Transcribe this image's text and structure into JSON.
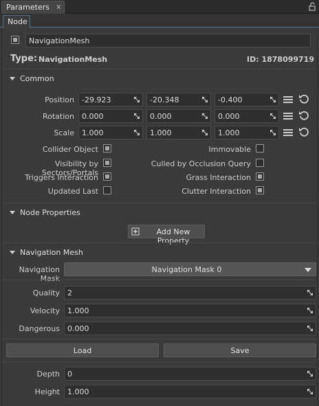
{
  "panel": {
    "tab_label": "Parameters",
    "tab_close": "x",
    "lock_icon": "lock-icon"
  },
  "node_tab": {
    "label": "Node"
  },
  "node": {
    "name": "NavigationMesh",
    "type_label": "Type:",
    "type_value": "NavigationMesh",
    "id_text": "ID: 1878099719",
    "enabled": true
  },
  "common": {
    "title": "Common",
    "position": {
      "label": "Position",
      "x": "-29.923",
      "y": "-20.348",
      "z": "-0.400"
    },
    "rotation": {
      "label": "Rotation",
      "x": "0.000",
      "y": "0.000",
      "z": "0.000"
    },
    "scale": {
      "label": "Scale",
      "x": "1.000",
      "y": "1.000",
      "z": "1.000"
    },
    "flags_left": [
      {
        "label": "Collider Object",
        "checked": true
      },
      {
        "label": "Visibility by Sectors/Portals",
        "checked": true
      },
      {
        "label": "Triggers Interaction",
        "checked": true
      },
      {
        "label": "Updated Last",
        "checked": false
      }
    ],
    "flags_right": [
      {
        "label": "Immovable",
        "checked": false
      },
      {
        "label": "Culled by Occlusion Query",
        "checked": false
      },
      {
        "label": "Grass Interaction",
        "checked": true
      },
      {
        "label": "Clutter Interaction",
        "checked": true
      }
    ]
  },
  "node_properties": {
    "title": "Node Properties",
    "add_button": "Add New Property"
  },
  "navigation_mesh": {
    "title": "Navigation Mesh",
    "mask_label": "Navigation Mask",
    "mask_value": "Navigation Mask 0",
    "quality": {
      "label": "Quality",
      "value": "2"
    },
    "velocity": {
      "label": "Velocity",
      "value": "1.000"
    },
    "dangerous": {
      "label": "Dangerous",
      "value": "0.000"
    },
    "load_button": "Load",
    "save_button": "Save",
    "depth": {
      "label": "Depth",
      "value": "0"
    },
    "height": {
      "label": "Height",
      "value": "1.000"
    }
  },
  "colors": {
    "accent_border": "#55708a",
    "panel_bg": "#3a3a3a",
    "field_bg": "#2e2e2e"
  }
}
